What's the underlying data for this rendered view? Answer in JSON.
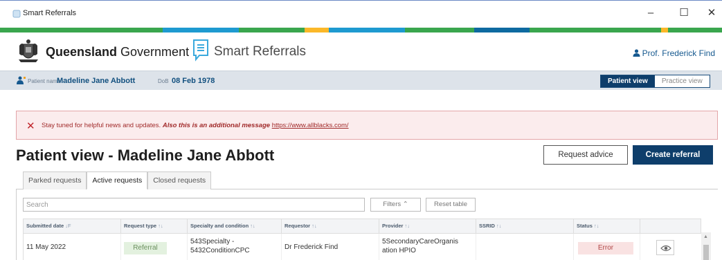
{
  "window": {
    "title": "Smart Referrals",
    "minimize": "–",
    "maximize": "☐",
    "close": "✕"
  },
  "brand": {
    "gov_bold": "Queensland",
    "gov_light": " Government",
    "app_name": "Smart Referrals"
  },
  "user": {
    "name": "Prof. Frederick Find"
  },
  "patient_bar": {
    "name_label": "Patient name",
    "name_value": "Madeline Jane Abbott",
    "dob_label": "DoB",
    "dob_value": "08 Feb 1978",
    "patient_view": "Patient view",
    "practice_view": "Practice view"
  },
  "alert": {
    "icon": "✕",
    "text": "Stay tuned for helpful news and updates.",
    "emphasis": "Also this is an additional message",
    "link": "https://www.allblacks.com/"
  },
  "page": {
    "title": "Patient view - Madeline Jane Abbott",
    "request_advice": "Request advice",
    "create_referral": "Create referral"
  },
  "tabs": [
    {
      "label": "Parked requests"
    },
    {
      "label": "Active requests"
    },
    {
      "label": "Closed requests"
    }
  ],
  "toolbar": {
    "search_placeholder": "Search",
    "filters": "Filters  ⌃",
    "reset": "Reset table"
  },
  "table": {
    "columns": [
      {
        "label": "Submitted date",
        "sort": "↓F"
      },
      {
        "label": "Request type",
        "sort": "↑↓"
      },
      {
        "label": "Specialty and condition",
        "sort": "↑↓"
      },
      {
        "label": "Requestor",
        "sort": "↑↓"
      },
      {
        "label": "Provider",
        "sort": "↑↓"
      },
      {
        "label": "SSRID",
        "sort": "↑↓"
      },
      {
        "label": "Status",
        "sort": "↑↓"
      },
      {
        "label": "",
        "sort": ""
      }
    ],
    "rows": [
      {
        "date": "11 May 2022",
        "type": "Referral",
        "specialty_line1": "543Specialty -",
        "specialty_line2": "5432ConditionCPC",
        "requestor": "Dr Frederick Find",
        "provider_line1": "5SecondaryCareOrganis",
        "provider_line2": "ation HPIO",
        "ssrid": "",
        "status": "Error"
      }
    ]
  },
  "colors": {
    "primary": "#0e3e6b",
    "link": "#16598f",
    "alert_bg": "#fbeced",
    "alert_text": "#a12a2a",
    "stripe": [
      "#3aa64e",
      "#1e9ad0",
      "#fbb829",
      "#0e6aa0"
    ]
  }
}
